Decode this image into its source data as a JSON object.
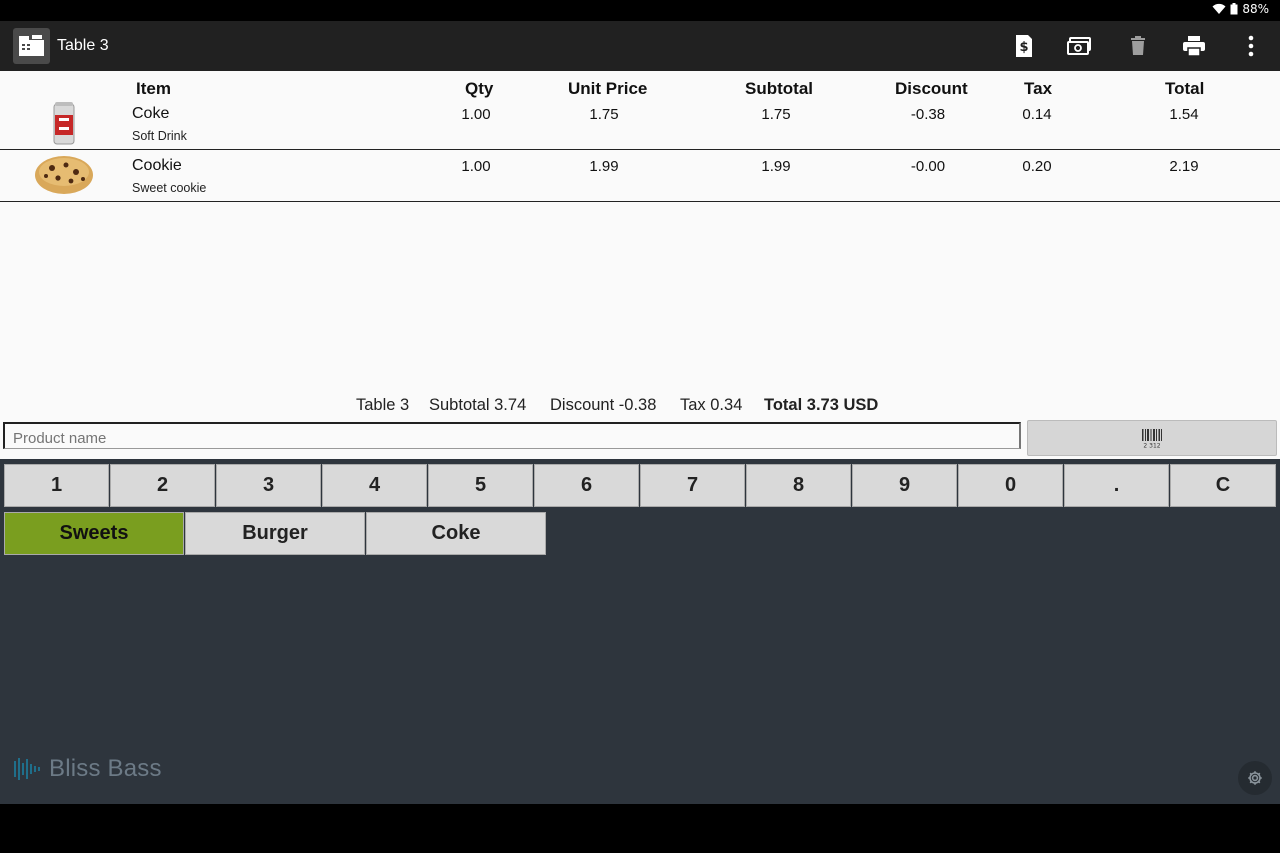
{
  "status": {
    "battery": "88%"
  },
  "toolbar": {
    "title": "Table 3"
  },
  "table": {
    "headers": [
      "Item",
      "Qty",
      "Unit Price",
      "Subtotal",
      "Discount",
      "Tax",
      "Total"
    ],
    "rows": [
      {
        "name": "Coke",
        "desc": "Soft Drink",
        "qty": "1.00",
        "unit_price": "1.75",
        "subtotal": "1.75",
        "discount": "-0.38",
        "tax": "0.14",
        "total": "1.54"
      },
      {
        "name": "Cookie",
        "desc": "Sweet cookie",
        "qty": "1.00",
        "unit_price": "1.99",
        "subtotal": "1.99",
        "discount": "-0.00",
        "tax": "0.20",
        "total": "2.19"
      }
    ]
  },
  "summary": {
    "table": "Table 3",
    "subtotal": "Subtotal 3.74",
    "discount": "Discount -0.38",
    "tax": "Tax 0.34",
    "total": "Total 3.73 USD"
  },
  "search": {
    "placeholder": "Product name"
  },
  "keypad": [
    "1",
    "2",
    "3",
    "4",
    "5",
    "6",
    "7",
    "8",
    "9",
    "0",
    ".",
    "C"
  ],
  "categories": [
    {
      "label": "Sweets",
      "active": true
    },
    {
      "label": "Burger",
      "active": false
    },
    {
      "label": "Coke",
      "active": false
    }
  ],
  "brand": {
    "name": "Bliss Bass"
  },
  "colors": {
    "toolbar": "#212121",
    "panel": "#2e353d",
    "active_category": "#7a9e1f",
    "key": "#d9d9d9"
  },
  "icons": [
    "wifi-icon",
    "battery-icon",
    "register-icon",
    "bill-icon",
    "cash-icon",
    "trash-icon",
    "printer-icon",
    "overflow-menu-icon",
    "barcode-icon",
    "gear-icon"
  ]
}
